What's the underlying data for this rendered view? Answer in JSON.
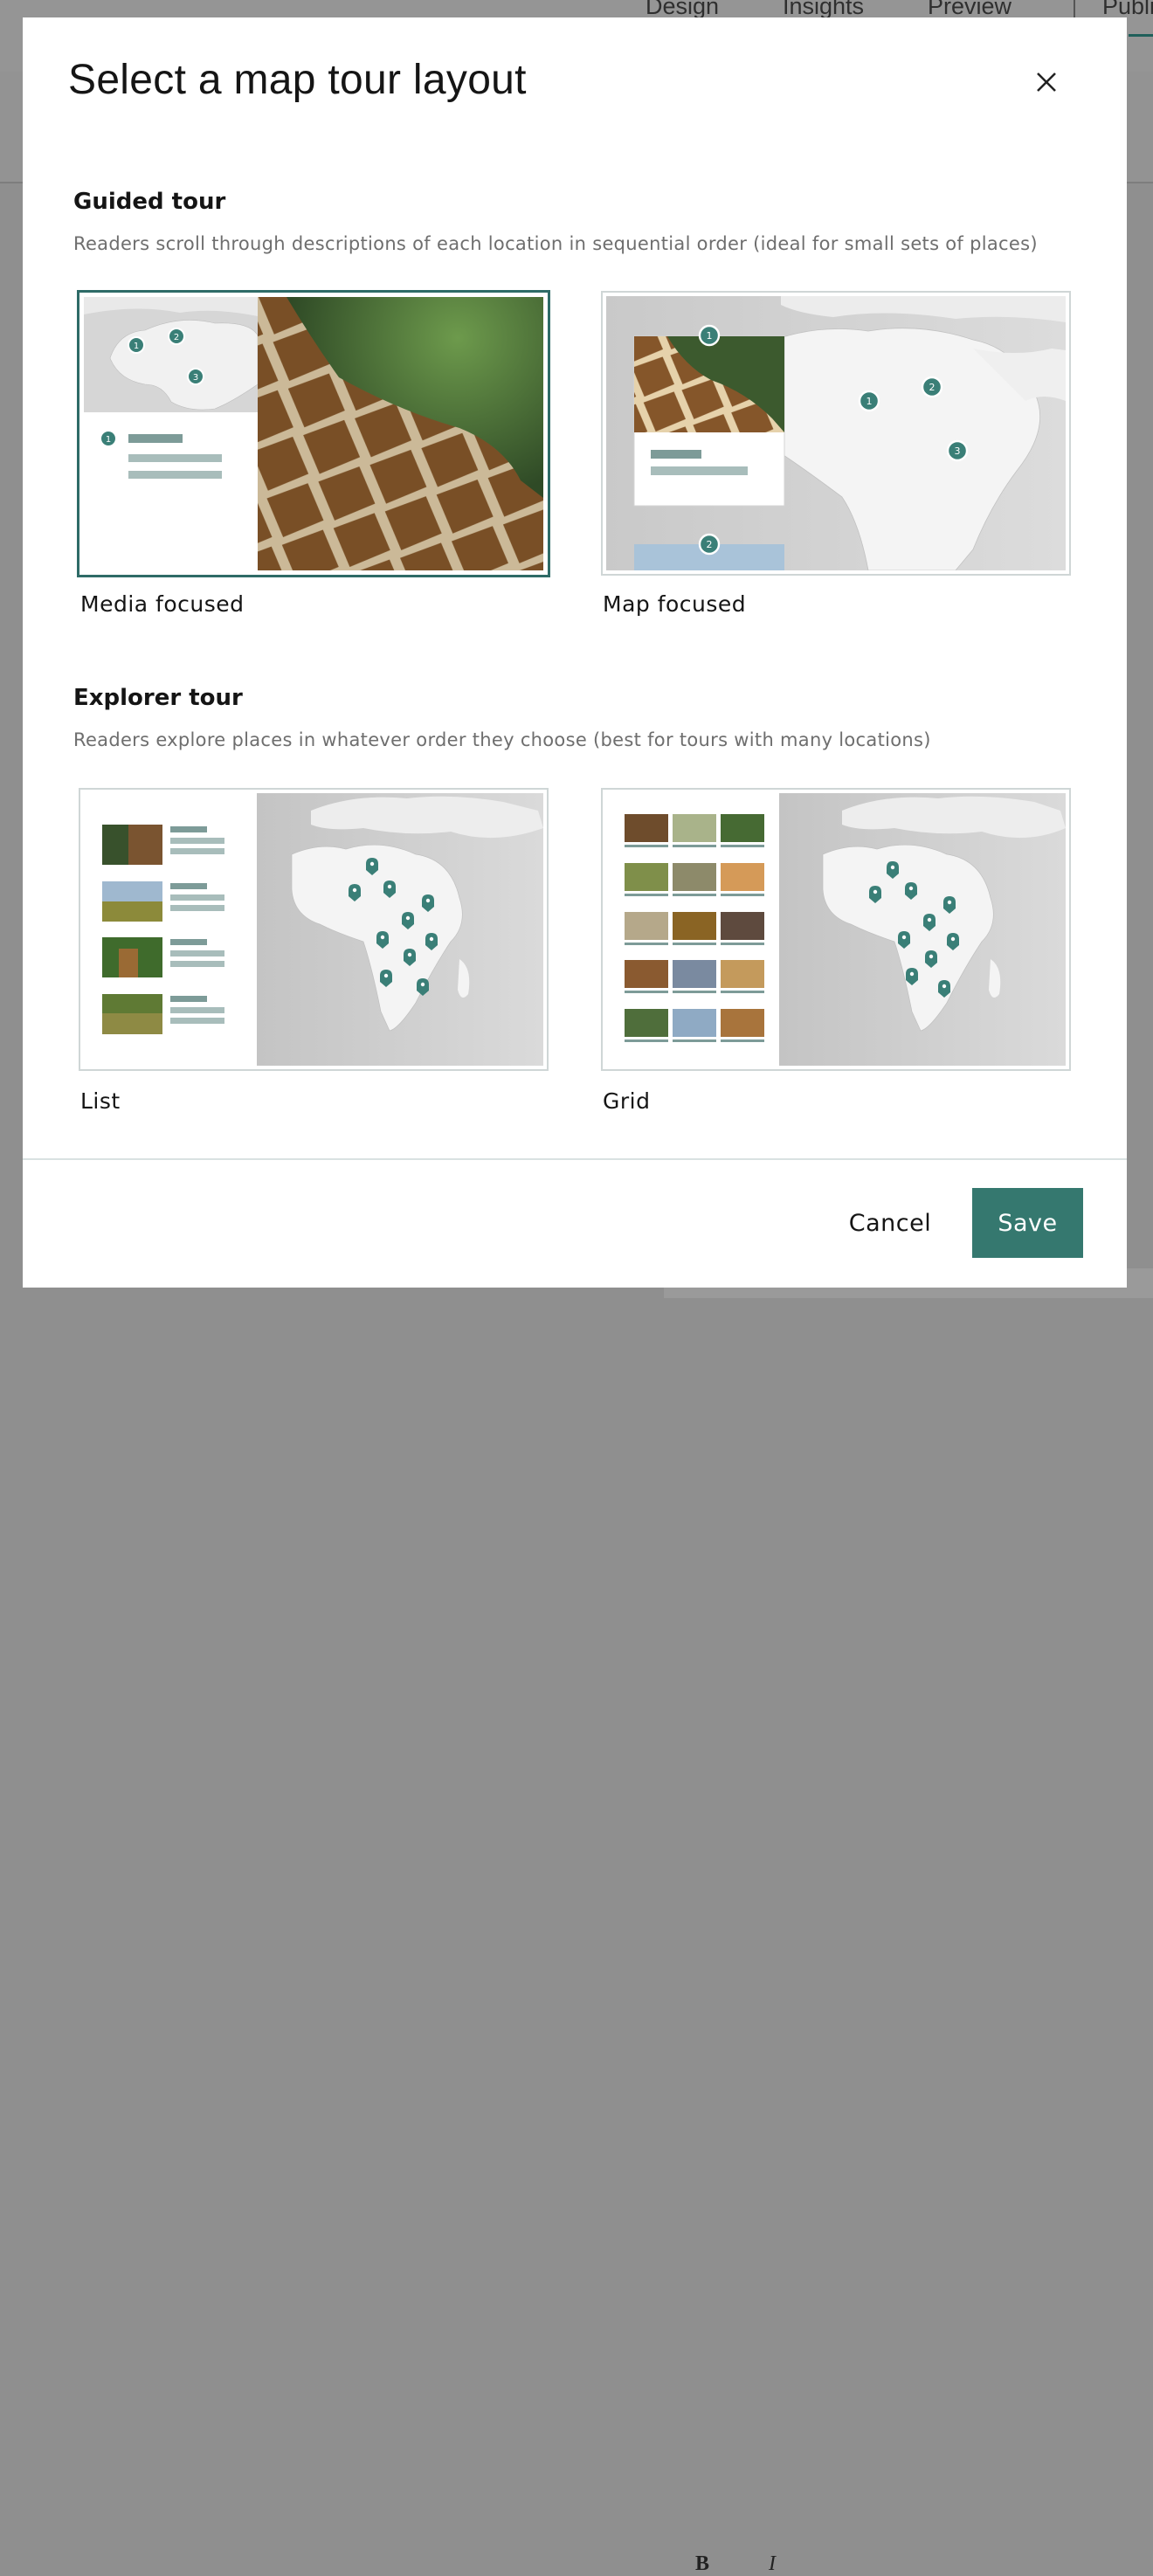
{
  "background": {
    "tabs": [
      "Design",
      "Insights",
      "Preview",
      "Publi"
    ]
  },
  "dialog": {
    "title": "Select a map tour layout",
    "close_icon": "close-icon"
  },
  "guided": {
    "heading": "Guided tour",
    "description": "Readers scroll through descriptions of each location in sequential order (ideal for small sets of places)",
    "options": [
      {
        "label": "Media focused",
        "selected": true
      },
      {
        "label": "Map focused",
        "selected": false
      }
    ]
  },
  "explorer": {
    "heading": "Explorer tour",
    "description": "Readers explore places in whatever order they choose (best for tours with many locations)",
    "options": [
      {
        "label": "List",
        "selected": false
      },
      {
        "label": "Grid",
        "selected": false
      }
    ]
  },
  "thumbnails": {
    "markers": [
      "1",
      "2",
      "3"
    ]
  },
  "footer": {
    "cancel_label": "Cancel",
    "save_label": "Save"
  },
  "colors": {
    "accent": "#35786f",
    "selected_border": "#2e6b67",
    "marker": "#3a7f77"
  }
}
